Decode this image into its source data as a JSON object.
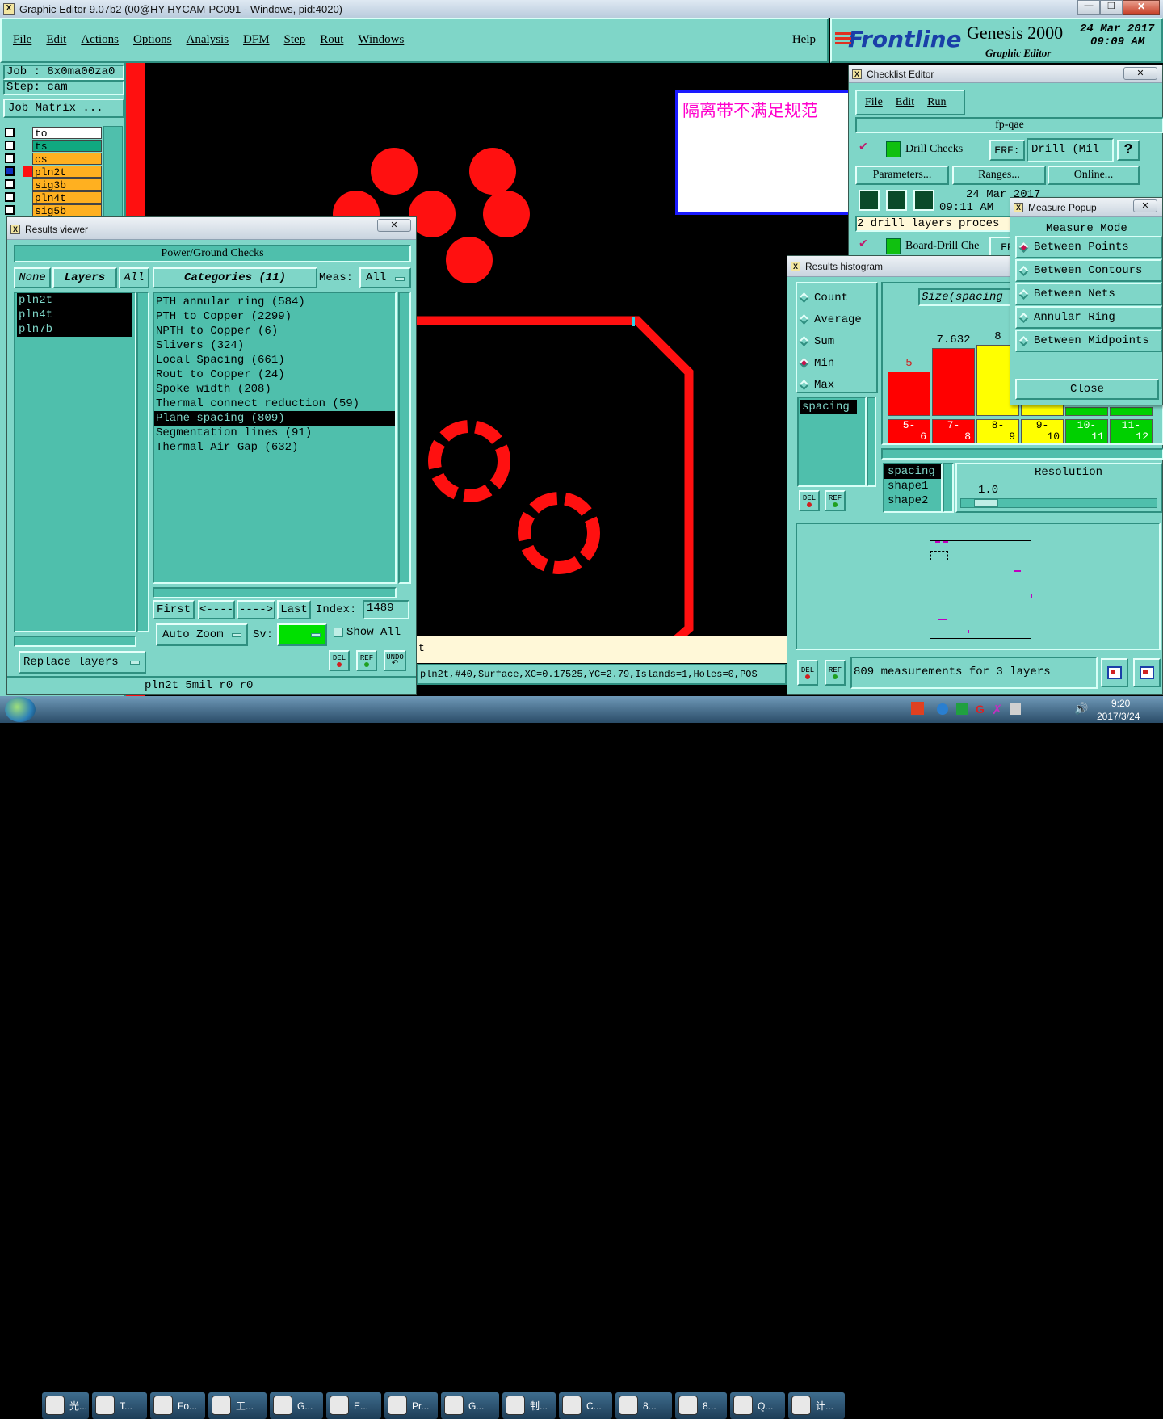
{
  "window": {
    "title": "Graphic Editor 9.07b2 (00@HY-HYCAM-PC091 - Windows, pid:4020)"
  },
  "menu": {
    "items": [
      "File",
      "Edit",
      "Actions",
      "Options",
      "Analysis",
      "DFM",
      "Step",
      "Rout",
      "Windows"
    ],
    "help": "Help"
  },
  "brand": {
    "logo": "Frontline",
    "product": "Genesis 2000",
    "subtitle": "Graphic Editor",
    "date": "24 Mar 2017",
    "time": "09:09 AM"
  },
  "job": {
    "job_label": "Job  :  8x0ma00za0",
    "step_label": "Step:  cam",
    "matrix_btn": "Job Matrix ..."
  },
  "layers": [
    "to",
    "ts",
    "cs",
    "pln2t",
    "sig3b",
    "pln4t",
    "sig5b"
  ],
  "annotation": {
    "text": "隔离带不满足规范"
  },
  "results_viewer": {
    "title": "Results viewer",
    "header": "Power/Ground Checks",
    "none_btn": "None",
    "layers_btn": "Layers",
    "all_btn": "All",
    "categories_btn": "Categories (11)",
    "meas_label": "Meas:",
    "meas_value": "All",
    "layer_list": [
      "pln2t",
      "pln4t",
      "pln7b"
    ],
    "categories": [
      "PTH annular ring (584)",
      "PTH to Copper (2299)",
      "NPTH to Copper (6)",
      "Slivers (324)",
      "Local Spacing (661)",
      "Rout to Copper (24)",
      "Spoke width (208)",
      "Thermal connect reduction (59)",
      "Plane spacing (809)",
      "Segmentation lines (91)",
      "Thermal Air Gap (632)"
    ],
    "selected_category": 8,
    "first_btn": "First",
    "prev_btn": "<----",
    "next_btn": "---->",
    "last_btn": "Last",
    "index_label": "Index:",
    "index_value": "1489",
    "auto_zoom": "Auto Zoom",
    "sv_label": "Sv:",
    "show_all": "Show All",
    "replace_layers": "Replace layers",
    "del": "DEL",
    "ref": "REF",
    "undo": "UNDO",
    "status": "pln2t  5mil   r0   r0"
  },
  "canvas_status": "pln2t,#40,Surface,XC=0.17525,YC=2.79,Islands=1,Holes=0,POS",
  "canvas_status_short": "t",
  "checklist": {
    "title": "Checklist Editor",
    "menu": [
      "File",
      "Edit",
      "Run"
    ],
    "name": "fp-qae",
    "row1_label": "Drill Checks",
    "erf_label": "ERF:",
    "erf_value": "Drill (Mil",
    "help_btn": "?",
    "params_btn": "Parameters...",
    "ranges_btn": "Ranges...",
    "online_btn": "Online...",
    "date": "24 Mar 2017",
    "time": "09:11 AM",
    "status_text": "2 drill layers proces",
    "row2_label": "Board-Drill Che",
    "row2_erf": "ER"
  },
  "histogram": {
    "title": "Results histogram",
    "stats": [
      "Count",
      "Average",
      "Sum",
      "Min",
      "Max"
    ],
    "selected_stat": "Min",
    "size_label": "Size(spacing",
    "field_list": [
      "spacing"
    ],
    "bars": [
      {
        "range_top": "5-",
        "range_bottom": "6",
        "label": "5",
        "value": 5,
        "color": "#ff0000"
      },
      {
        "range_top": "7-",
        "range_bottom": "8",
        "label": "7.632",
        "value": 7.632,
        "color": "#ff0000"
      },
      {
        "range_top": "8-",
        "range_bottom": "9",
        "label": "8",
        "value": 8,
        "color": "#ffff00"
      },
      {
        "range_top": "9-",
        "range_bottom": "10",
        "label": "",
        "value": 7,
        "color": "#ffff00"
      },
      {
        "range_top": "10-",
        "range_bottom": "11",
        "label": "",
        "value": 1,
        "color": "#00d000"
      },
      {
        "range_top": "11-",
        "range_bottom": "12",
        "label": "",
        "value": 1,
        "color": "#00d000"
      }
    ],
    "shape_list": [
      "spacing",
      "shape1",
      "shape2"
    ],
    "resolution_label": "Resolution",
    "resolution_value": "1.0",
    "del": "DEL",
    "ref": "REF",
    "measurements": "809 measurements for 3 layers"
  },
  "measure_popup": {
    "title": "Measure Popup",
    "mode_label": "Measure Mode",
    "options": [
      "Between Points",
      "Between Contours",
      "Between Nets",
      "Annular Ring",
      "Between Midpoints"
    ],
    "selected": "Between Points",
    "close_btn": "Close"
  },
  "taskbar": {
    "items": [
      "光...",
      "T...",
      "Fo...",
      "工...",
      "G...",
      "E...",
      "Pr...",
      "G...",
      "制...",
      "C...",
      "8...",
      "8...",
      "Q...",
      "计..."
    ],
    "clock_time": "9:20",
    "clock_date": "2017/3/24"
  },
  "colors": {
    "teal": "#7fd6c8",
    "canvas": "#000000",
    "feature": "#ff0000",
    "annotation": "#ff00cc"
  }
}
